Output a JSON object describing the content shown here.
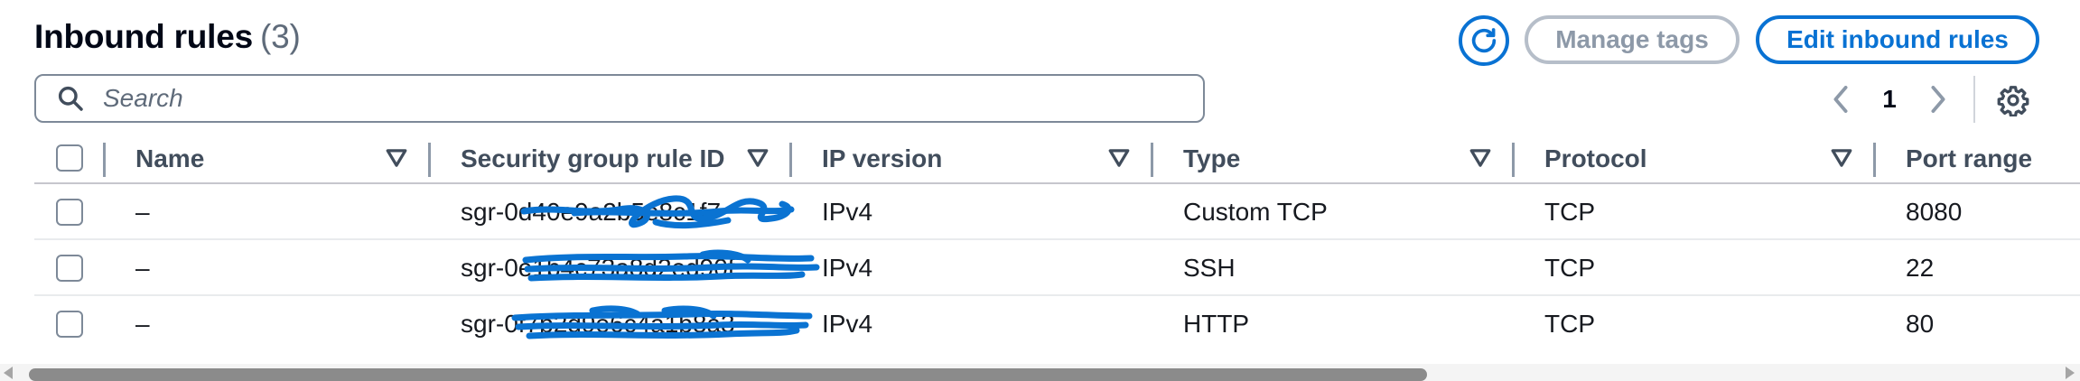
{
  "header": {
    "title": "Inbound rules",
    "count": "(3)"
  },
  "toolbar": {
    "refresh_icon": "refresh-icon",
    "manage_tags_label": "Manage tags",
    "edit_rules_label": "Edit inbound rules"
  },
  "search": {
    "placeholder": "Search",
    "value": ""
  },
  "pagination": {
    "current_page": "1",
    "prev_icon": "chevron-left-icon",
    "next_icon": "chevron-right-icon"
  },
  "settings_icon": "gear-icon",
  "table": {
    "columns": [
      "Name",
      "Security group rule ID",
      "IP version",
      "Type",
      "Protocol",
      "Port range"
    ],
    "rows": [
      {
        "name": "–",
        "rule_id": "sgr-0d40e9a2b5e8c1f7",
        "ip_version": "IPv4",
        "type": "Custom TCP",
        "protocol": "TCP",
        "port_range": "8080"
      },
      {
        "name": "–",
        "rule_id": "sgr-0e1b4c73a8d2ed90f",
        "ip_version": "IPv4",
        "type": "SSH",
        "protocol": "TCP",
        "port_range": "22"
      },
      {
        "name": "–",
        "rule_id": "sgr-0f7b2d9e6c4a1b8a3",
        "ip_version": "IPv4",
        "type": "HTTP",
        "protocol": "TCP",
        "port_range": "80"
      }
    ]
  },
  "colors": {
    "primary": "#0972d3",
    "disabled": "#8d99a8",
    "redaction": "#0a73d2"
  }
}
